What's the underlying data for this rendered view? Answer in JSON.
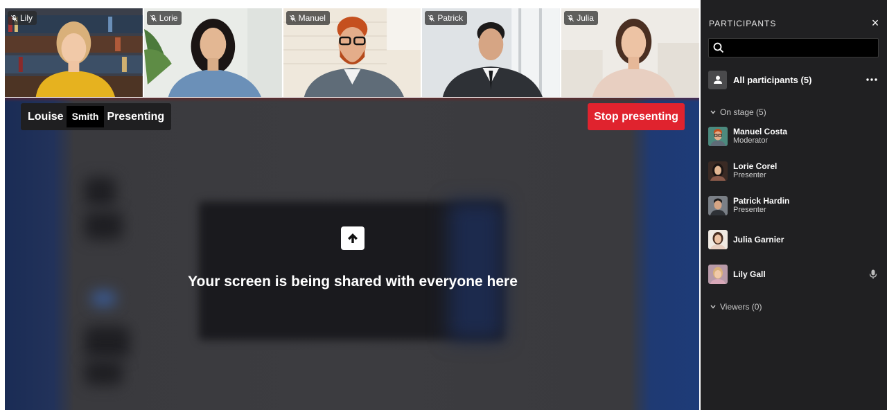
{
  "tiles": [
    {
      "name": "Lily"
    },
    {
      "name": "Lorie"
    },
    {
      "name": "Manuel"
    },
    {
      "name": "Patrick"
    },
    {
      "name": "Julia"
    }
  ],
  "presenter": {
    "first": "Louise",
    "last": "Smith",
    "status": "Presenting"
  },
  "stop_button": "Stop presenting",
  "share_message": "Your screen is being shared with everyone here",
  "sidebar": {
    "title": "PARTICIPANTS",
    "close": "×",
    "search_placeholder": "",
    "all_participants": "All participants (5)",
    "more": "•••",
    "on_stage_label": "On stage (5)",
    "viewers_label": "Viewers (0)",
    "on_stage": [
      {
        "name": "Manuel Costa",
        "role": "Moderator"
      },
      {
        "name": "Lorie Corel",
        "role": "Presenter"
      },
      {
        "name": "Patrick Hardin",
        "role": "Presenter"
      },
      {
        "name": "Julia Garnier",
        "role": ""
      },
      {
        "name": "Lily Gall",
        "role": ""
      }
    ]
  },
  "colors": {
    "accent_red": "#e0232e",
    "sidebar_bg": "#202022",
    "share_blue": "#1d3b78"
  },
  "icons": {
    "muted": "mic-off-icon",
    "search": "search-icon",
    "close": "close-icon",
    "more": "more-horizontal-icon",
    "chevron": "chevron-down-icon",
    "share": "arrow-up-icon",
    "mic": "mic-icon",
    "group": "person-icon"
  }
}
